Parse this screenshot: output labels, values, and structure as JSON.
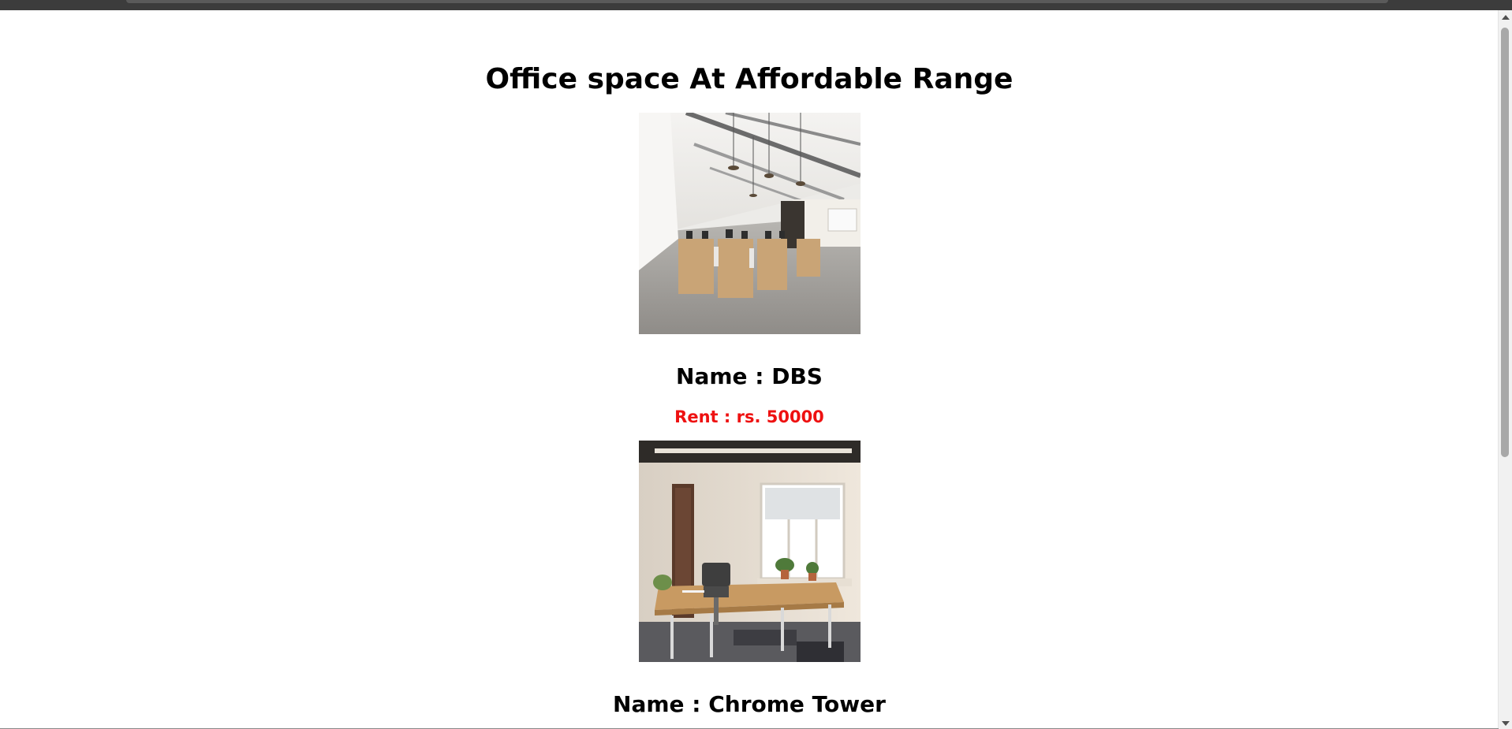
{
  "page": {
    "title": "Office space At Affordable Range"
  },
  "listings": [
    {
      "name": "Name : DBS",
      "rent": "Rent : rs. 50000",
      "image_alt": "open-plan office interior with desks and pendant lights"
    },
    {
      "name": "Name : Chrome Tower",
      "image_alt": "private office with wooden desk, chair and window"
    }
  ],
  "colors": {
    "rent_text": "#ee1111",
    "heading_text": "#000000",
    "background": "#ffffff"
  }
}
